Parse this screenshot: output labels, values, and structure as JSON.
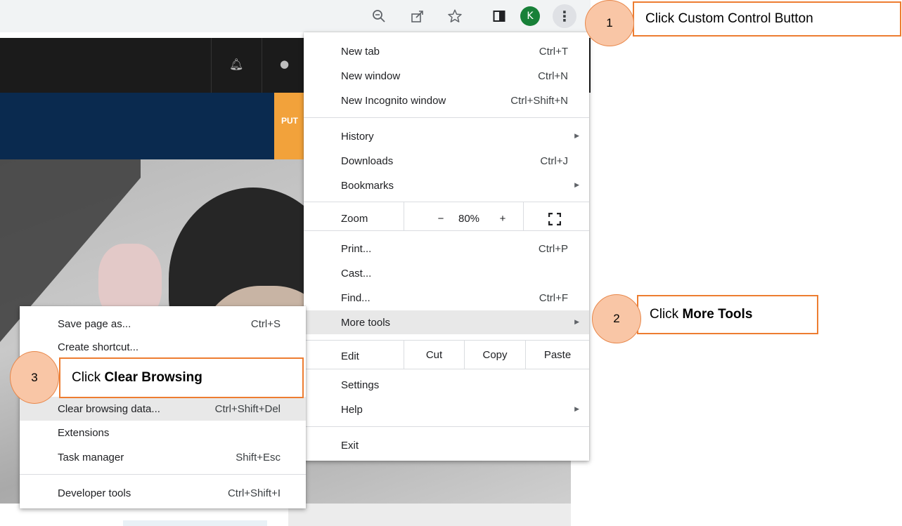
{
  "toolbar": {
    "icons": [
      "zoom-out-icon",
      "share-icon",
      "star-icon",
      "side-panel-icon"
    ],
    "avatar_letter": "K",
    "menu_button_glyph": "⋮"
  },
  "site": {
    "banner_button_text": "PUT"
  },
  "main_menu": {
    "new_tab": {
      "label": "New tab",
      "shortcut": "Ctrl+T"
    },
    "new_window": {
      "label": "New window",
      "shortcut": "Ctrl+N"
    },
    "new_incognito": {
      "label": "New Incognito window",
      "shortcut": "Ctrl+Shift+N"
    },
    "history": {
      "label": "History"
    },
    "downloads": {
      "label": "Downloads",
      "shortcut": "Ctrl+J"
    },
    "bookmarks": {
      "label": "Bookmarks"
    },
    "zoom": {
      "label": "Zoom",
      "minus": "−",
      "level": "80%",
      "plus": "+"
    },
    "print": {
      "label": "Print...",
      "shortcut": "Ctrl+P"
    },
    "cast": {
      "label": "Cast..."
    },
    "find": {
      "label": "Find...",
      "shortcut": "Ctrl+F"
    },
    "more_tools": {
      "label": "More tools"
    },
    "edit": {
      "label": "Edit",
      "cut": "Cut",
      "copy": "Copy",
      "paste": "Paste"
    },
    "settings": {
      "label": "Settings"
    },
    "help": {
      "label": "Help"
    },
    "exit": {
      "label": "Exit"
    }
  },
  "sub_menu": {
    "save_page": {
      "label": "Save page as...",
      "shortcut": "Ctrl+S"
    },
    "create_shortcut": {
      "label": "Create shortcut..."
    },
    "clear_browsing": {
      "label": "Clear browsing data...",
      "shortcut": "Ctrl+Shift+Del"
    },
    "extensions": {
      "label": "Extensions"
    },
    "task_manager": {
      "label": "Task manager",
      "shortcut": "Shift+Esc"
    },
    "developer_tools": {
      "label": "Developer tools",
      "shortcut": "Ctrl+Shift+I"
    }
  },
  "callouts": {
    "c1": {
      "number": "1",
      "text": "Click Custom Control Button"
    },
    "c2": {
      "number": "2",
      "prefix": "Click ",
      "bold": "More Tools"
    },
    "c3": {
      "number": "3",
      "prefix": "Click ",
      "bold": "Clear Browsing"
    }
  },
  "colors": {
    "callout_border": "#ed7d31",
    "callout_bubble": "#f9c6a6",
    "avatar": "#188038",
    "menu_highlight": "#e8e8e8"
  }
}
